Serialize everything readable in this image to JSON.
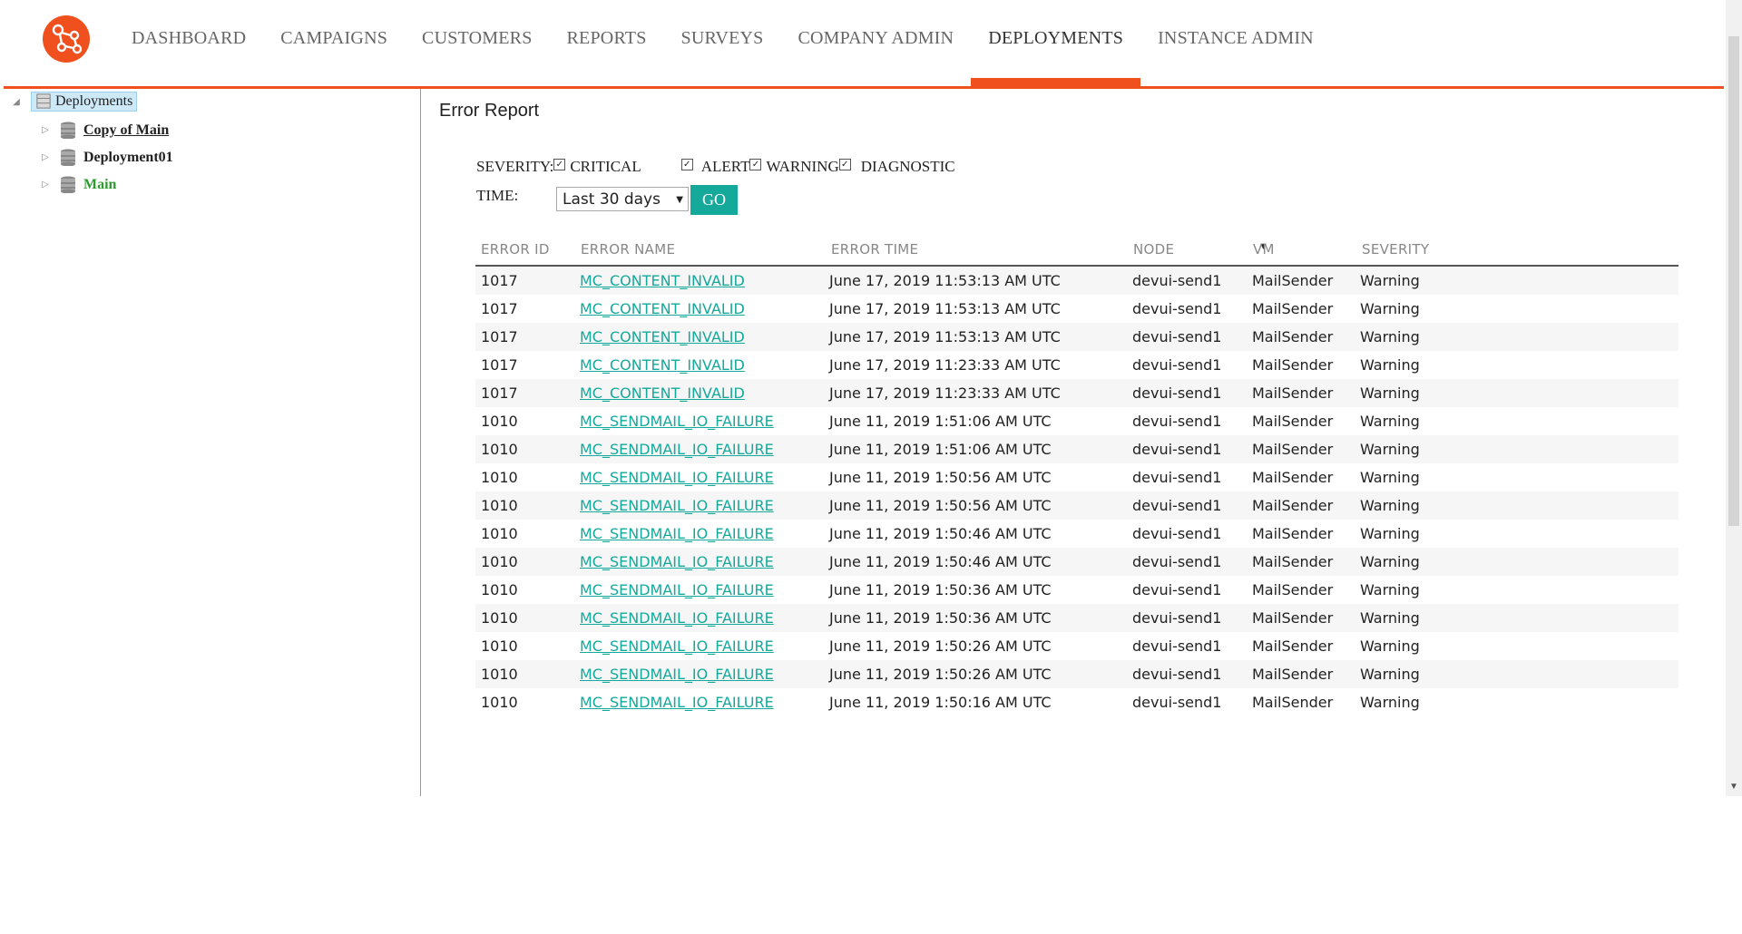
{
  "nav": {
    "items": [
      {
        "label": "DASHBOARD"
      },
      {
        "label": "CAMPAIGNS"
      },
      {
        "label": "CUSTOMERS"
      },
      {
        "label": "REPORTS"
      },
      {
        "label": "SURVEYS"
      },
      {
        "label": "COMPANY ADMIN"
      },
      {
        "label": "DEPLOYMENTS",
        "active": true
      },
      {
        "label": "INSTANCE ADMIN"
      }
    ],
    "accent_color": "#f0501e"
  },
  "sidebar": {
    "root": {
      "label": "Deployments"
    },
    "children": [
      {
        "label": "Copy of Main"
      },
      {
        "label": "Deployment01"
      },
      {
        "label": "Main"
      }
    ]
  },
  "report": {
    "title": "Error Report",
    "severity_label": "SEVERITY:",
    "severities": [
      {
        "label": "CRITICAL",
        "checked": true
      },
      {
        "label": "ALERT",
        "checked": true
      },
      {
        "label": "WARNING",
        "checked": true
      },
      {
        "label": "DIAGNOSTIC",
        "checked": true
      }
    ],
    "time_label": "TIME:",
    "time_value": "Last 30 days",
    "go_label": "GO",
    "button_color": "#14a99a"
  },
  "table": {
    "headers": [
      "ERROR ID",
      "ERROR NAME",
      "ERROR TIME",
      "NODE",
      "VM",
      "SEVERITY"
    ],
    "sorted_column": "ERROR TIME",
    "rows": [
      [
        "1017",
        "MC_CONTENT_INVALID",
        "June 17, 2019 11:53:13 AM UTC",
        "devui-send1",
        "MailSender",
        "Warning"
      ],
      [
        "1017",
        "MC_CONTENT_INVALID",
        "June 17, 2019 11:53:13 AM UTC",
        "devui-send1",
        "MailSender",
        "Warning"
      ],
      [
        "1017",
        "MC_CONTENT_INVALID",
        "June 17, 2019 11:53:13 AM UTC",
        "devui-send1",
        "MailSender",
        "Warning"
      ],
      [
        "1017",
        "MC_CONTENT_INVALID",
        "June 17, 2019 11:23:33 AM UTC",
        "devui-send1",
        "MailSender",
        "Warning"
      ],
      [
        "1017",
        "MC_CONTENT_INVALID",
        "June 17, 2019 11:23:33 AM UTC",
        "devui-send1",
        "MailSender",
        "Warning"
      ],
      [
        "1010",
        "MC_SENDMAIL_IO_FAILURE",
        "June 11, 2019 1:51:06 AM UTC",
        "devui-send1",
        "MailSender",
        "Warning"
      ],
      [
        "1010",
        "MC_SENDMAIL_IO_FAILURE",
        "June 11, 2019 1:51:06 AM UTC",
        "devui-send1",
        "MailSender",
        "Warning"
      ],
      [
        "1010",
        "MC_SENDMAIL_IO_FAILURE",
        "June 11, 2019 1:50:56 AM UTC",
        "devui-send1",
        "MailSender",
        "Warning"
      ],
      [
        "1010",
        "MC_SENDMAIL_IO_FAILURE",
        "June 11, 2019 1:50:56 AM UTC",
        "devui-send1",
        "MailSender",
        "Warning"
      ],
      [
        "1010",
        "MC_SENDMAIL_IO_FAILURE",
        "June 11, 2019 1:50:46 AM UTC",
        "devui-send1",
        "MailSender",
        "Warning"
      ],
      [
        "1010",
        "MC_SENDMAIL_IO_FAILURE",
        "June 11, 2019 1:50:46 AM UTC",
        "devui-send1",
        "MailSender",
        "Warning"
      ],
      [
        "1010",
        "MC_SENDMAIL_IO_FAILURE",
        "June 11, 2019 1:50:36 AM UTC",
        "devui-send1",
        "MailSender",
        "Warning"
      ],
      [
        "1010",
        "MC_SENDMAIL_IO_FAILURE",
        "June 11, 2019 1:50:36 AM UTC",
        "devui-send1",
        "MailSender",
        "Warning"
      ],
      [
        "1010",
        "MC_SENDMAIL_IO_FAILURE",
        "June 11, 2019 1:50:26 AM UTC",
        "devui-send1",
        "MailSender",
        "Warning"
      ],
      [
        "1010",
        "MC_SENDMAIL_IO_FAILURE",
        "June 11, 2019 1:50:26 AM UTC",
        "devui-send1",
        "MailSender",
        "Warning"
      ],
      [
        "1010",
        "MC_SENDMAIL_IO_FAILURE",
        "June 11, 2019 1:50:16 AM UTC",
        "devui-send1",
        "MailSender",
        "Warning"
      ]
    ]
  }
}
